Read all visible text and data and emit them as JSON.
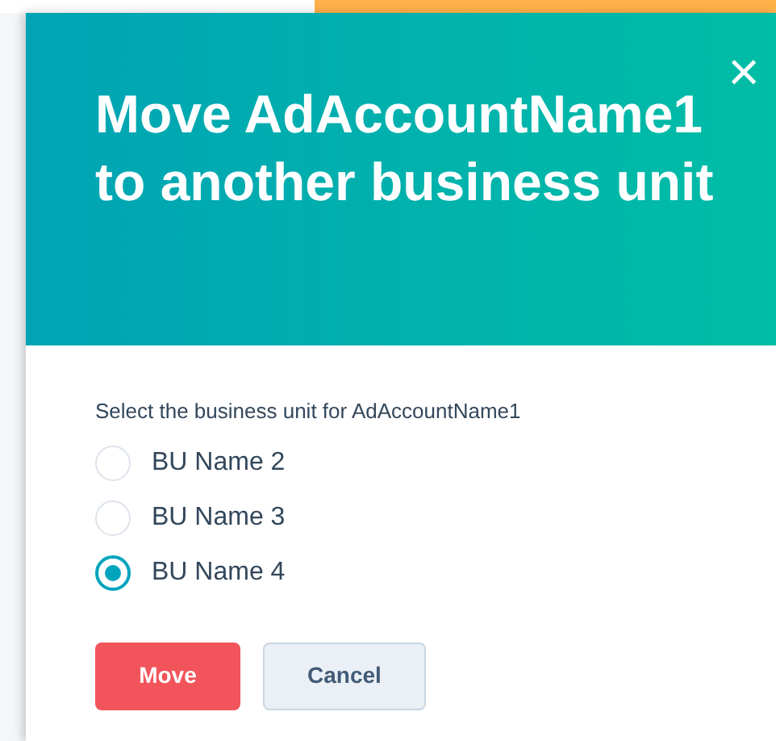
{
  "dialog": {
    "title": "Move AdAccountName1 to another business unit",
    "close": "×",
    "prompt": "Select the business unit for AdAccountName1",
    "options": [
      {
        "label": "BU Name 2",
        "selected": false
      },
      {
        "label": "BU Name 3",
        "selected": false
      },
      {
        "label": "BU Name 4",
        "selected": true
      }
    ],
    "buttons": [
      {
        "label": "Move",
        "kind": "primary"
      },
      {
        "label": "Cancel",
        "kind": "secondary"
      }
    ]
  }
}
